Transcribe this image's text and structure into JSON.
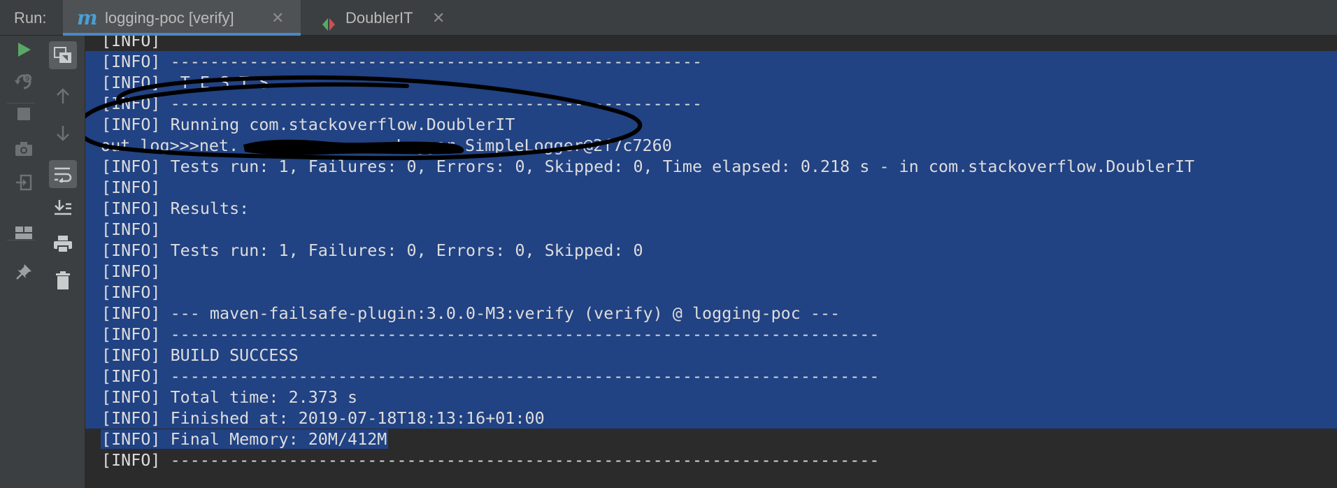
{
  "run_label": "Run:",
  "tabs": [
    {
      "label": "logging-poc [verify]",
      "icon": "maven-m-icon",
      "close": "✕",
      "active": true
    },
    {
      "label": "DoublerIT",
      "icon": "junit-icon",
      "close": "✕",
      "active": false
    }
  ],
  "toolbar_left": [
    "run-icon",
    "rerun-failed-icon",
    "stop-icon",
    "camera-icon",
    "login-icon",
    "layout-icon",
    "pin-icon"
  ],
  "toolbar_right": [
    "restore-layout-icon",
    "up-arrow-icon",
    "down-arrow-icon",
    "soft-wrap-icon",
    "scroll-to-end-icon",
    "print-icon",
    "trash-icon"
  ],
  "console_lines": [
    {
      "text": "[INFO]",
      "selection": "none"
    },
    {
      "text": "[INFO] ------------------------------------------------------",
      "selection": "full"
    },
    {
      "text": "[INFO]  T E S T S",
      "selection": "full"
    },
    {
      "text": "[INFO] ------------------------------------------------------",
      "selection": "full"
    },
    {
      "text": "[INFO] Running com.stackoverflow.DoublerIT",
      "selection": "full"
    },
    {
      "text": "out log>>>net.               .Logger.SimpleLogger@2f7c7260",
      "selection": "full"
    },
    {
      "text": "[INFO] Tests run: 1, Failures: 0, Errors: 0, Skipped: 0, Time elapsed: 0.218 s - in com.stackoverflow.DoublerIT",
      "selection": "full"
    },
    {
      "text": "[INFO]",
      "selection": "full"
    },
    {
      "text": "[INFO] Results:",
      "selection": "full"
    },
    {
      "text": "[INFO]",
      "selection": "full"
    },
    {
      "text": "[INFO] Tests run: 1, Failures: 0, Errors: 0, Skipped: 0",
      "selection": "full"
    },
    {
      "text": "[INFO]",
      "selection": "full"
    },
    {
      "text": "[INFO]",
      "selection": "full"
    },
    {
      "text": "[INFO] --- maven-failsafe-plugin:3.0.0-M3:verify (verify) @ logging-poc ---",
      "selection": "full"
    },
    {
      "text": "[INFO] ------------------------------------------------------------------------",
      "selection": "full"
    },
    {
      "text": "[INFO] BUILD SUCCESS",
      "selection": "full"
    },
    {
      "text": "[INFO] ------------------------------------------------------------------------",
      "selection": "full"
    },
    {
      "text": "[INFO] Total time: 2.373 s",
      "selection": "full"
    },
    {
      "text": "[INFO] Finished at: 2019-07-18T18:13:16+01:00",
      "selection": "full"
    },
    {
      "text": "[INFO] Final Memory: 20M/412M",
      "selection": "partial"
    },
    {
      "text": "[INFO] ------------------------------------------------------------------------",
      "selection": "none"
    }
  ],
  "colors": {
    "selection": "#214283",
    "console_bg": "#2b2b2b",
    "toolbar_bg": "#3c3f41",
    "run_green": "#59a869",
    "maven_blue": "#4a9fd8",
    "annotation": "#000000"
  }
}
